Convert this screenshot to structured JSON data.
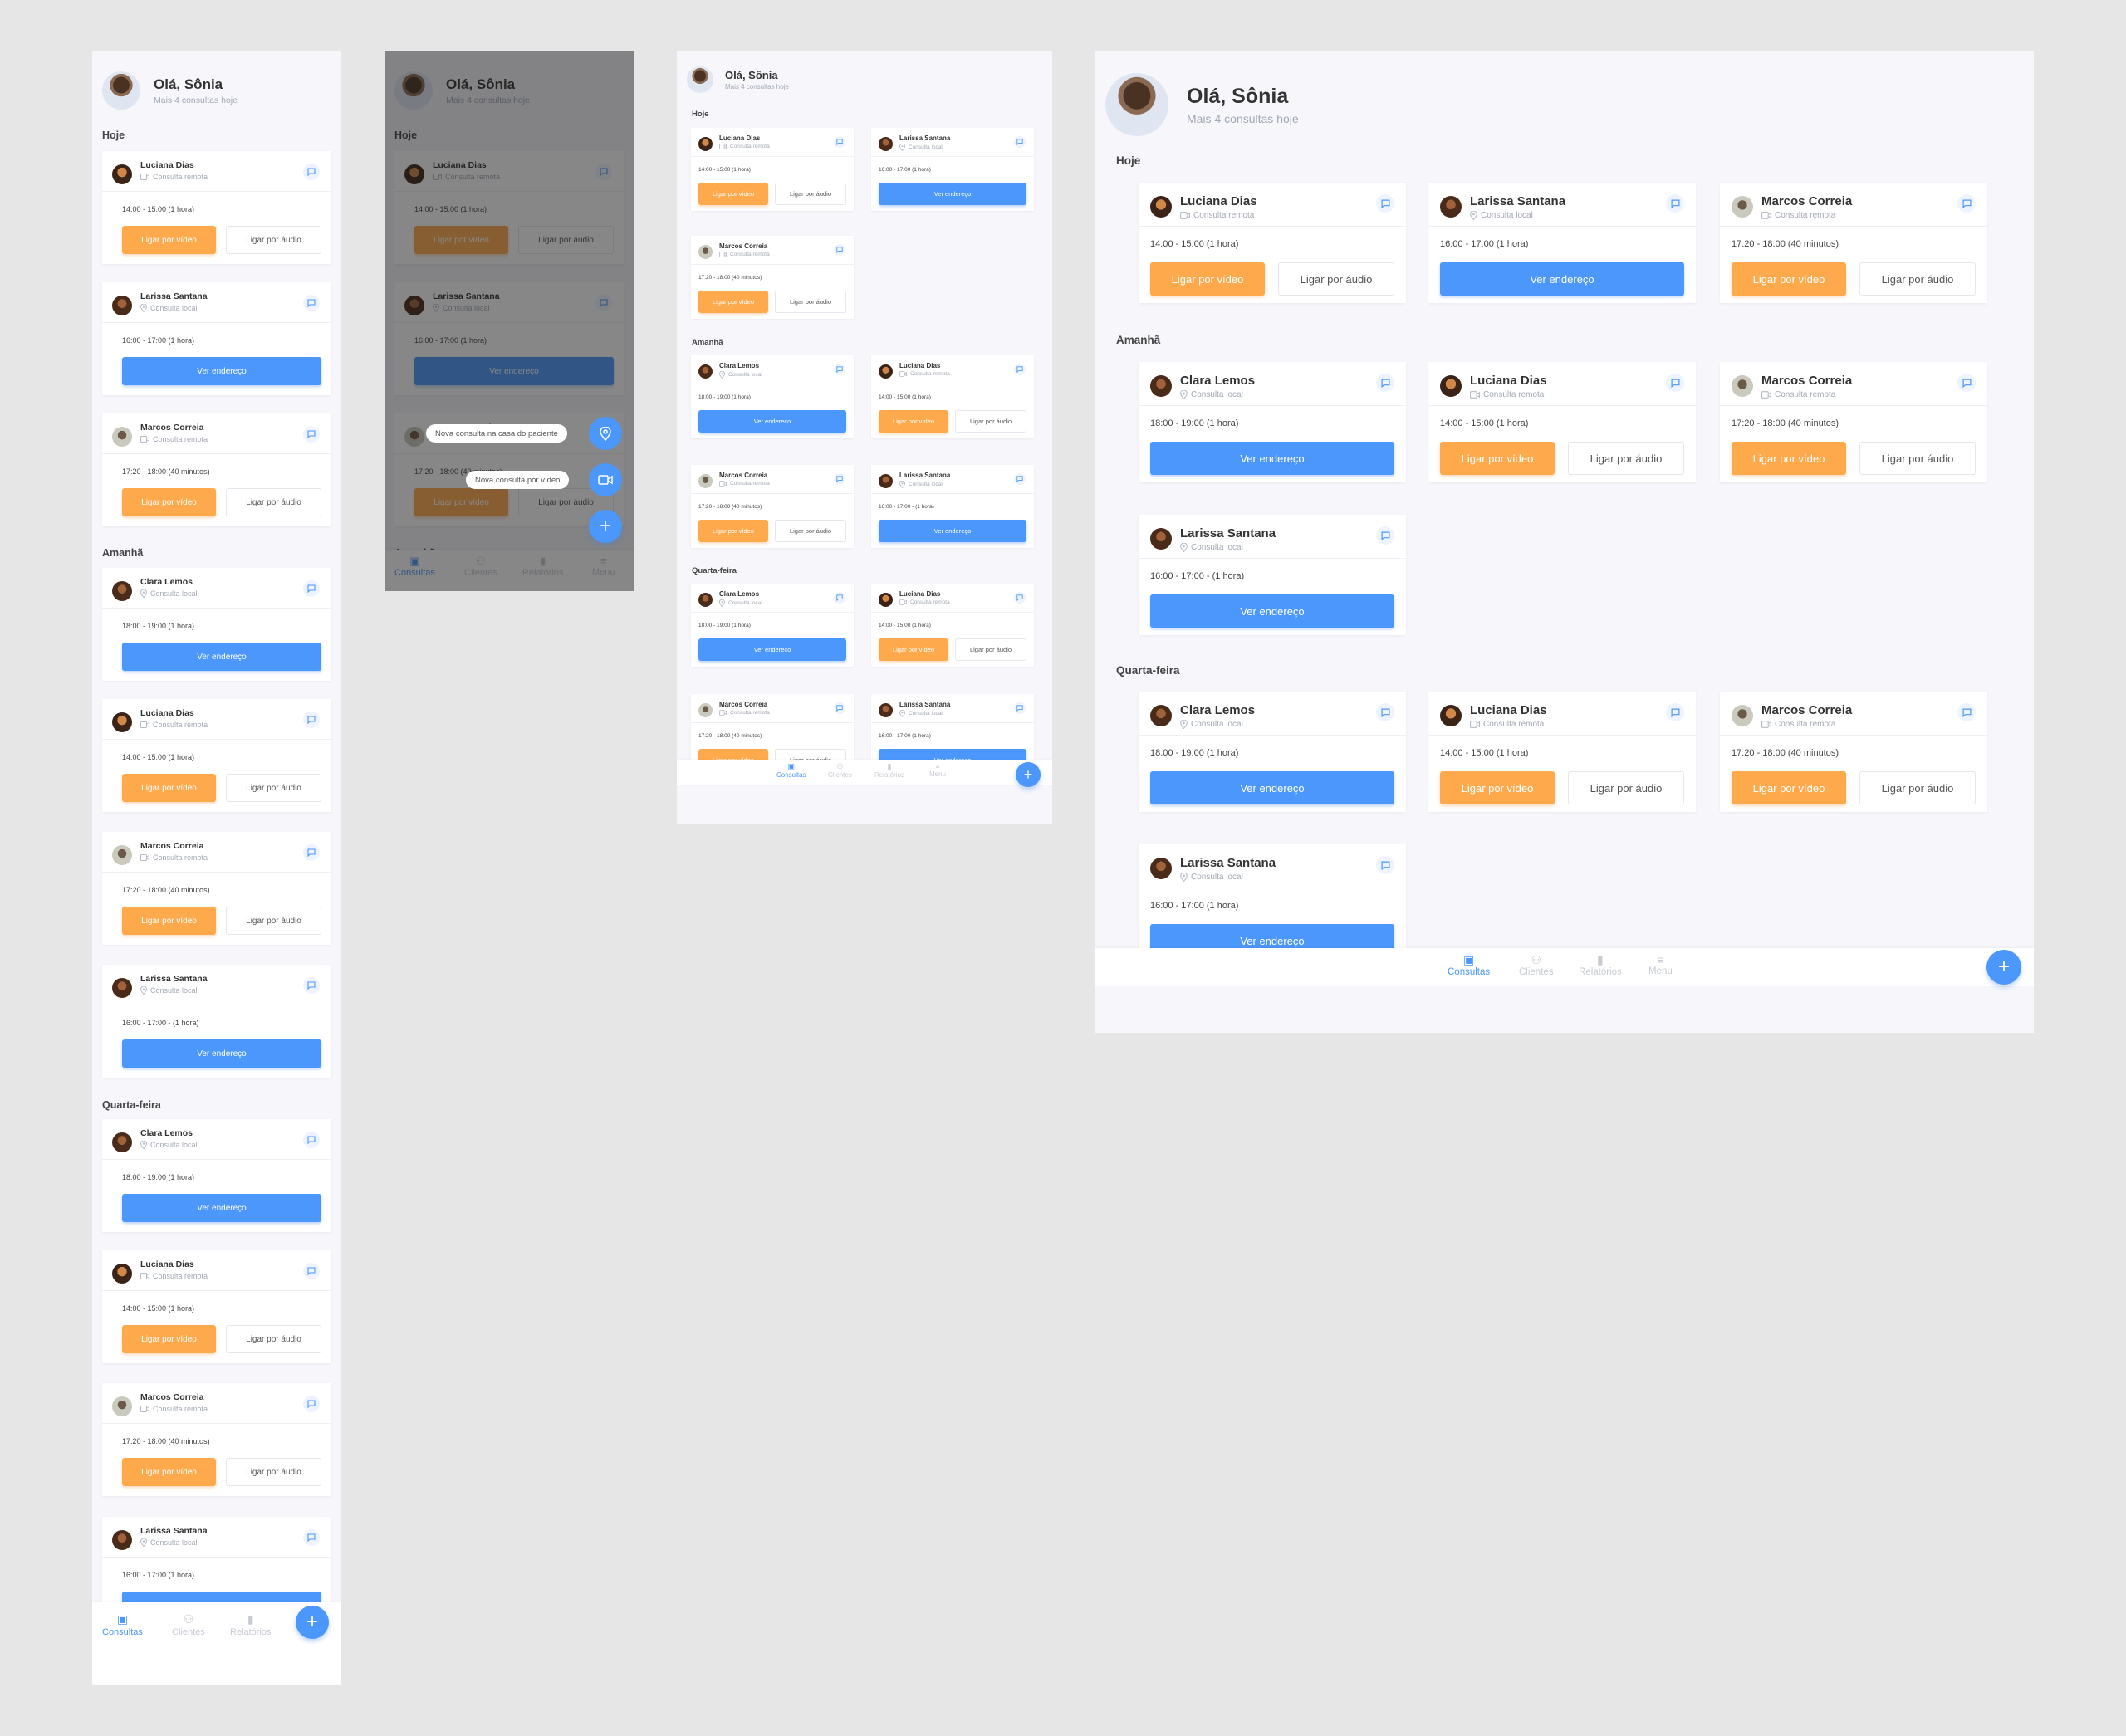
{
  "header": {
    "greeting": "Olá, Sônia",
    "subtitle": "Mais 4 consultas hoje"
  },
  "sections": {
    "today": "Hoje",
    "tomorrow": "Amanhã",
    "wednesday": "Quarta-feira"
  },
  "patients": {
    "luciana": {
      "name": "Luciana Dias",
      "type": "Consulta remota",
      "time": "14:00 - 15:00 (1 hora)"
    },
    "larissa": {
      "name": "Larissa Santana",
      "type": "Consulta local",
      "time": "16:00 - 17:00 (1 hora)",
      "time_alt": "16:00 - 17:00 - (1 hora)"
    },
    "marcos": {
      "name": "Marcos Correia",
      "type": "Consulta remota",
      "time": "17:20 - 18:00 (40 minutos)"
    },
    "clara": {
      "name": "Clara Lemos",
      "type": "Consulta local",
      "time": "18:00 - 19:00 (1 hora)"
    }
  },
  "buttons": {
    "video": "Ligar por vídeo",
    "audio": "Ligar por áudio",
    "address": "Ver endereço"
  },
  "nav": {
    "consultas": "Consultas",
    "clientes": "Clientes",
    "relatorios": "Relatórios",
    "menu": "Menu"
  },
  "fab": {
    "plus": "+",
    "home_visit": "Nova consulta na casa do paciente",
    "video_consult": "Nova consulta por vídeo"
  },
  "colors": {
    "primary": "#4b97fb",
    "accent": "#ffa94d",
    "background": "#f6f6fb",
    "canvas": "#e6e6e6"
  }
}
